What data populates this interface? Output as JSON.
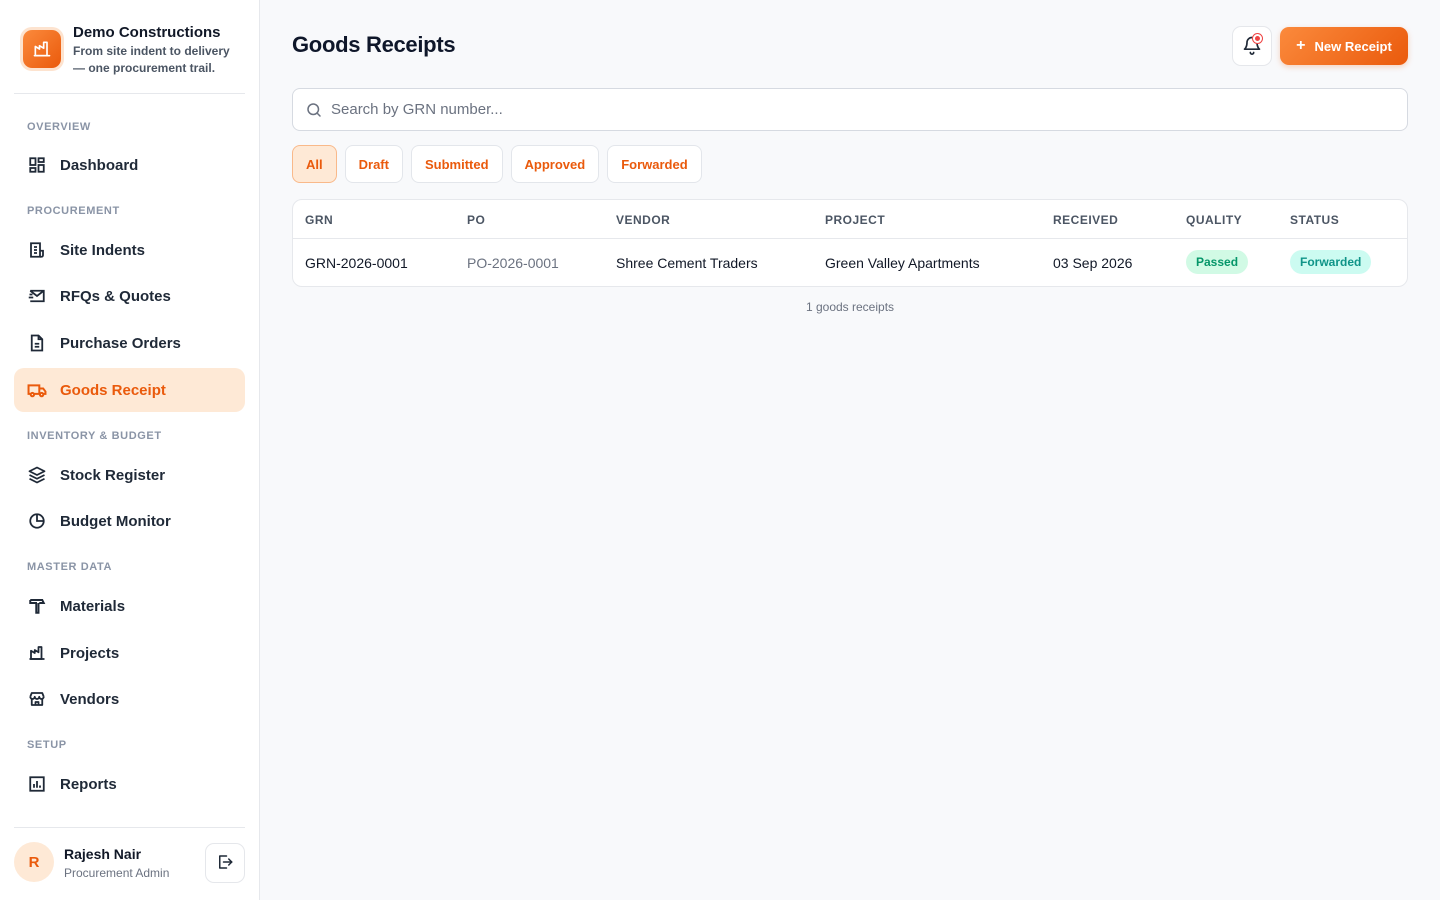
{
  "brand": {
    "name": "Demo Constructions",
    "tagline": "From site indent to delivery — one procurement trail."
  },
  "sidebar": {
    "sections": {
      "overview": "OVERVIEW",
      "procurement": "PROCUREMENT",
      "inventory": "INVENTORY & BUDGET",
      "master": "MASTER DATA",
      "setup": "SETUP"
    },
    "items": {
      "dashboard": "Dashboard",
      "site_indents": "Site Indents",
      "rfqs": "RFQs & Quotes",
      "purchase_orders": "Purchase Orders",
      "goods_receipt": "Goods Receipt",
      "stock_register": "Stock Register",
      "budget_monitor": "Budget Monitor",
      "materials": "Materials",
      "projects": "Projects",
      "vendors": "Vendors",
      "reports": "Reports"
    },
    "active_item": "goods_receipt"
  },
  "user": {
    "initial": "R",
    "name": "Rajesh Nair",
    "role": "Procurement Admin"
  },
  "header": {
    "title": "Goods Receipts",
    "new_button": "New Receipt"
  },
  "search": {
    "placeholder": "Search by GRN number...",
    "value": ""
  },
  "filters": [
    "All",
    "Draft",
    "Submitted",
    "Approved",
    "Forwarded"
  ],
  "active_filter": "All",
  "table": {
    "columns": [
      "GRN",
      "PO",
      "VENDOR",
      "PROJECT",
      "RECEIVED",
      "QUALITY",
      "STATUS"
    ],
    "rows": [
      {
        "grn": "GRN-2026-0001",
        "po": "PO-2026-0001",
        "vendor": "Shree Cement Traders",
        "project": "Green Valley Apartments",
        "received": "03 Sep 2026",
        "quality": "Passed",
        "status": "Forwarded"
      }
    ]
  },
  "footer": {
    "count_text": "1 goods receipts"
  },
  "colors": {
    "accent": "#ea5a0c",
    "accent_soft": "#fee9d6",
    "passed": "#059669",
    "forwarded": "#0f9488"
  }
}
